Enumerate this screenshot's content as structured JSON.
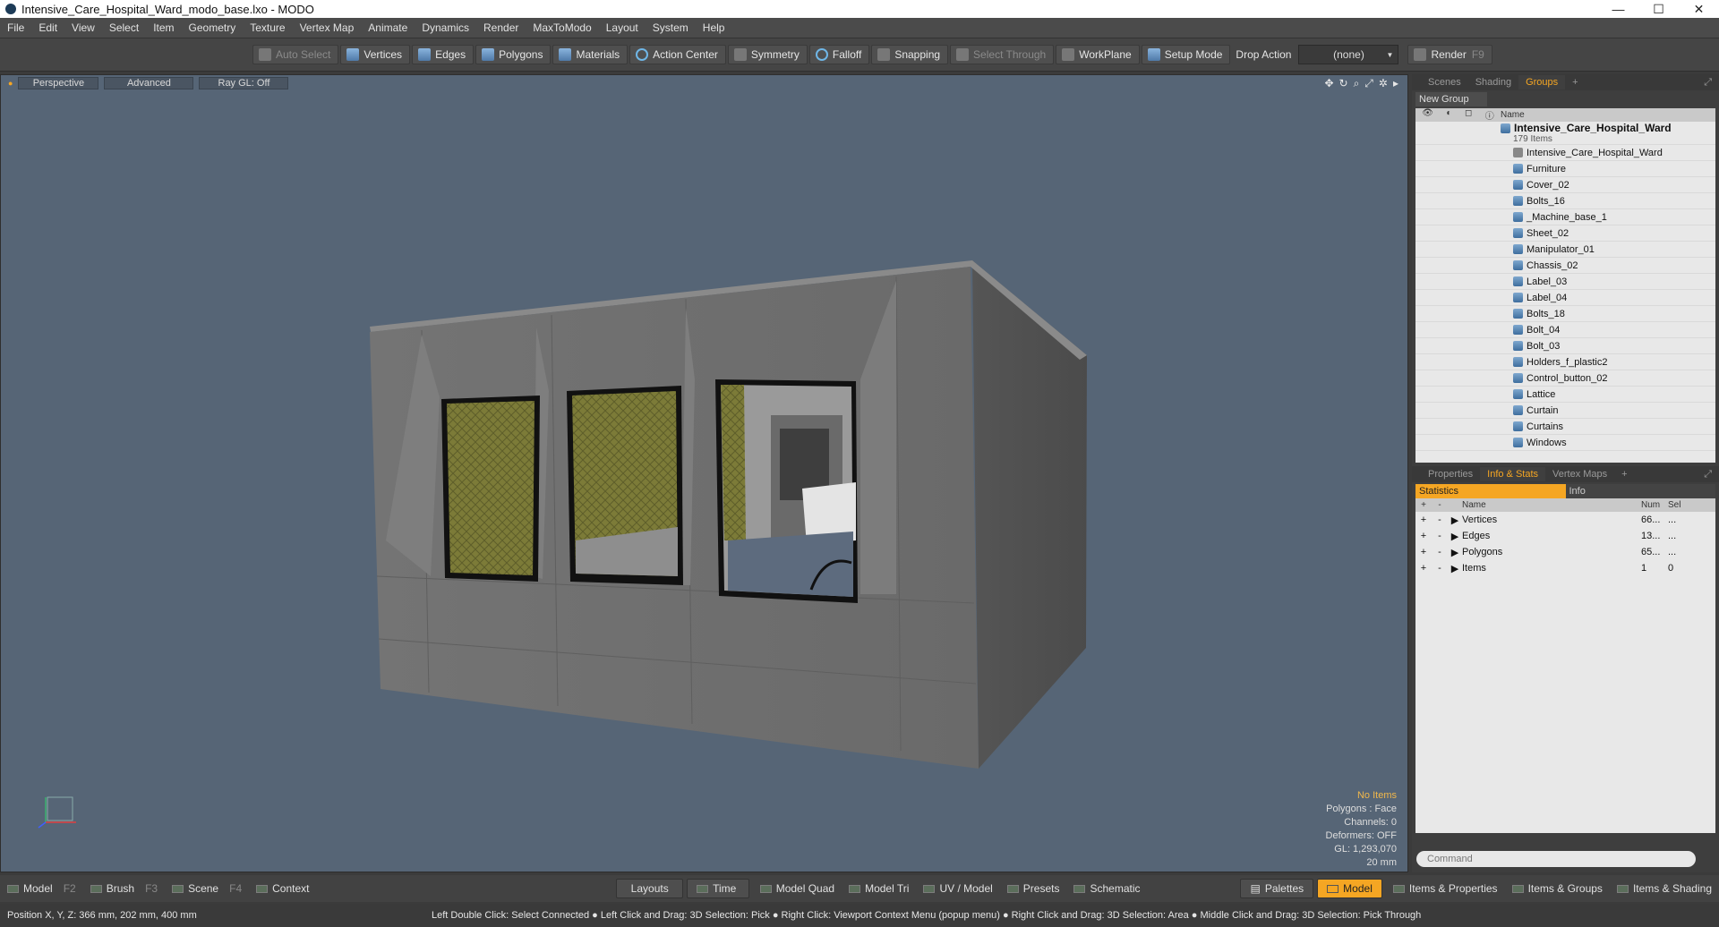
{
  "window": {
    "title": "Intensive_Care_Hospital_Ward_modo_base.lxo - MODO",
    "buttons": [
      "—",
      "☐",
      "✕"
    ]
  },
  "menu": [
    "File",
    "Edit",
    "View",
    "Select",
    "Item",
    "Geometry",
    "Texture",
    "Vertex Map",
    "Animate",
    "Dynamics",
    "Render",
    "MaxToModo",
    "Layout",
    "System",
    "Help"
  ],
  "toolbar": {
    "auto_select": "Auto Select",
    "vertices": "Vertices",
    "edges": "Edges",
    "polygons": "Polygons",
    "materials": "Materials",
    "action_center": "Action Center",
    "symmetry": "Symmetry",
    "falloff": "Falloff",
    "snapping": "Snapping",
    "select_through": "Select Through",
    "workplane": "WorkPlane",
    "setup_mode": "Setup Mode",
    "drop_action_label": "Drop Action",
    "drop_action_value": "(none)",
    "render": "Render",
    "render_key": "F9"
  },
  "viewport": {
    "tabs": [
      "Perspective",
      "Advanced",
      "Ray GL: Off"
    ],
    "info": [
      "No Items",
      "Polygons : Face",
      "Channels: 0",
      "Deformers: OFF",
      "GL: 1,293,070",
      "20 mm"
    ],
    "colors": {
      "background": "#566576",
      "wall": "#6b6b6b",
      "curtain": "#8a8a3a"
    }
  },
  "groups_panel": {
    "tabs": [
      "Scenes",
      "Shading",
      "Groups"
    ],
    "active_tab": "Groups",
    "new_group": "New Group",
    "name_header": "Name",
    "root_name": "Intensive_Care_Hospital_Ward",
    "root_count": "179 Items",
    "items": [
      "Intensive_Care_Hospital_Ward",
      "Furniture",
      "Cover_02",
      "Bolts_16",
      "_Machine_base_1",
      "Sheet_02",
      "Manipulator_01",
      "Chassis_02",
      "Label_03",
      "Label_04",
      "Bolts_18",
      "Bolt_04",
      "Bolt_03",
      "Holders_f_plastic2",
      "Control_button_02",
      "Lattice",
      "Curtain",
      "Curtains",
      "Windows"
    ]
  },
  "stats_panel": {
    "tabs": [
      "Properties",
      "Info & Stats",
      "Vertex Maps"
    ],
    "active_tab": "Info & Stats",
    "subtabs": [
      "Statistics",
      "Info"
    ],
    "headers": {
      "name": "Name",
      "num": "Num",
      "sel": "Sel"
    },
    "rows": [
      {
        "name": "Vertices",
        "num": "66...",
        "sel": "..."
      },
      {
        "name": "Edges",
        "num": "13...",
        "sel": "..."
      },
      {
        "name": "Polygons",
        "num": "65...",
        "sel": "..."
      },
      {
        "name": "Items",
        "num": "1",
        "sel": "0"
      }
    ],
    "command_placeholder": "Command"
  },
  "bottom": {
    "model": "Model",
    "model_key": "F2",
    "brush": "Brush",
    "brush_key": "F3",
    "scene": "Scene",
    "scene_key": "F4",
    "context": "Context",
    "layouts": "Layouts",
    "time": "Time",
    "model_quad": "Model Quad",
    "model_tri": "Model Tri",
    "uv_model": "UV / Model",
    "presets": "Presets",
    "schematic": "Schematic",
    "palettes": "Palettes",
    "model_active": "Model",
    "items_properties": "Items & Properties",
    "items_groups": "Items & Groups",
    "items_shading": "Items & Shading"
  },
  "status": {
    "position": "Position X, Y, Z:   366 mm, 202 mm, 400 mm",
    "hints": "Left Double Click: Select Connected ● Left Click and Drag: 3D Selection: Pick ● Right Click: Viewport Context Menu (popup menu) ● Right Click and Drag: 3D Selection: Area ● Middle Click and Drag: 3D Selection: Pick Through"
  }
}
